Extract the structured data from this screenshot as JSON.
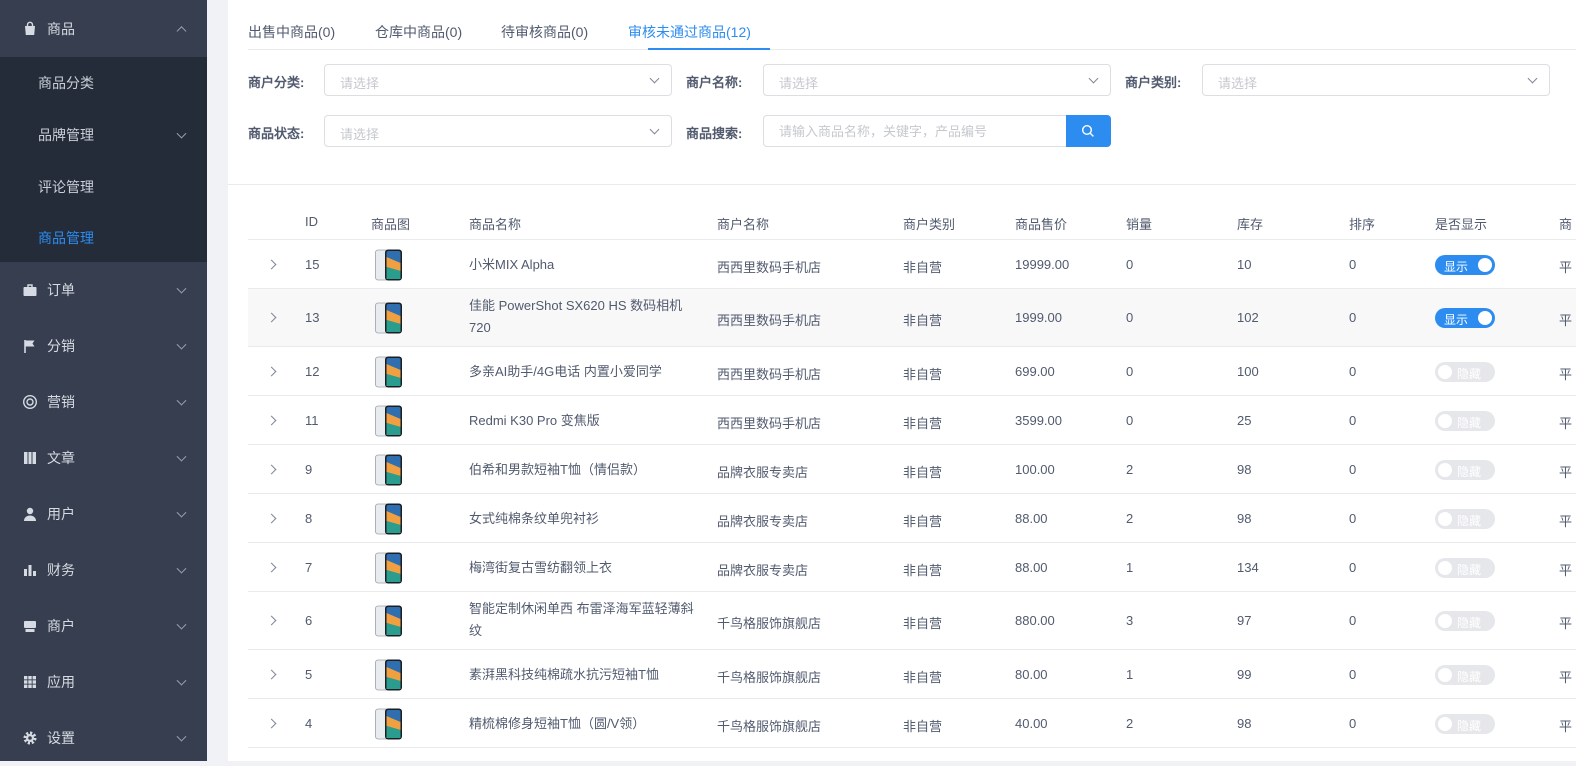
{
  "sidebar": {
    "menu": [
      {
        "label": "商品",
        "icon": "bag-icon"
      },
      {
        "label": "订单",
        "icon": "briefcase-icon"
      },
      {
        "label": "分销",
        "icon": "flag-icon"
      },
      {
        "label": "营销",
        "icon": "lifebuoy-icon"
      },
      {
        "label": "文章",
        "icon": "book-icon"
      },
      {
        "label": "用户",
        "icon": "user-icon"
      },
      {
        "label": "财务",
        "icon": "bar-chart-icon"
      },
      {
        "label": "商户",
        "icon": "store-icon"
      },
      {
        "label": "应用",
        "icon": "grid-icon"
      },
      {
        "label": "设置",
        "icon": "gear-icon"
      }
    ],
    "submenu": [
      {
        "label": "商品分类"
      },
      {
        "label": "品牌管理"
      },
      {
        "label": "评论管理"
      },
      {
        "label": "商品管理"
      }
    ]
  },
  "tabs": [
    {
      "label": "出售中商品(0)"
    },
    {
      "label": "仓库中商品(0)"
    },
    {
      "label": "待审核商品(0)"
    },
    {
      "label": "审核未通过商品(12)"
    }
  ],
  "filters": {
    "merchant_category": {
      "label": "商户分类:",
      "placeholder": "请选择"
    },
    "merchant_name": {
      "label": "商户名称:",
      "placeholder": "请选择"
    },
    "merchant_type": {
      "label": "商户类别:",
      "placeholder": "请选择"
    },
    "product_status": {
      "label": "商品状态:",
      "placeholder": "请选择"
    },
    "product_search": {
      "label": "商品搜索:",
      "placeholder": "请输入商品名称，关键字，产品编号"
    }
  },
  "table": {
    "headers": {
      "id": "ID",
      "image": "商品图",
      "name": "商品名称",
      "merchant": "商户名称",
      "merchant_type": "商户类别",
      "price": "商品售价",
      "sales": "销量",
      "stock": "库存",
      "sort": "排序",
      "show": "是否显示",
      "extra": "商"
    },
    "rows": [
      {
        "id": "15",
        "name": "小米MIX Alpha",
        "merchant": "西西里数码手机店",
        "type": "非自营",
        "price": "19999.00",
        "sales": "0",
        "stock": "10",
        "sort": "0",
        "show": "显示",
        "on": true,
        "extra": "平"
      },
      {
        "id": "13",
        "name": "佳能 PowerShot SX620 HS 数码相机 720",
        "merchant": "西西里数码手机店",
        "type": "非自营",
        "price": "1999.00",
        "sales": "0",
        "stock": "102",
        "sort": "0",
        "show": "显示",
        "on": true,
        "extra": "平"
      },
      {
        "id": "12",
        "name": "多亲AI助手/4G电话 内置小爱同学",
        "merchant": "西西里数码手机店",
        "type": "非自营",
        "price": "699.00",
        "sales": "0",
        "stock": "100",
        "sort": "0",
        "show": "隐藏",
        "on": false,
        "extra": "平"
      },
      {
        "id": "11",
        "name": "Redmi K30 Pro 变焦版",
        "merchant": "西西里数码手机店",
        "type": "非自营",
        "price": "3599.00",
        "sales": "0",
        "stock": "25",
        "sort": "0",
        "show": "隐藏",
        "on": false,
        "extra": "平"
      },
      {
        "id": "9",
        "name": "伯希和男款短袖T恤（情侣款）",
        "merchant": "品牌衣服专卖店",
        "type": "非自营",
        "price": "100.00",
        "sales": "2",
        "stock": "98",
        "sort": "0",
        "show": "隐藏",
        "on": false,
        "extra": "平"
      },
      {
        "id": "8",
        "name": "女式纯棉条纹单兜衬衫",
        "merchant": "品牌衣服专卖店",
        "type": "非自营",
        "price": "88.00",
        "sales": "2",
        "stock": "98",
        "sort": "0",
        "show": "隐藏",
        "on": false,
        "extra": "平"
      },
      {
        "id": "7",
        "name": "梅湾街复古雪纺翻领上衣",
        "merchant": "品牌衣服专卖店",
        "type": "非自营",
        "price": "88.00",
        "sales": "1",
        "stock": "134",
        "sort": "0",
        "show": "隐藏",
        "on": false,
        "extra": "平"
      },
      {
        "id": "6",
        "name": "智能定制休闲单西 布雷泽海军蓝轻薄斜纹",
        "merchant": "千鸟格服饰旗舰店",
        "type": "非自营",
        "price": "880.00",
        "sales": "3",
        "stock": "97",
        "sort": "0",
        "show": "隐藏",
        "on": false,
        "extra": "平"
      },
      {
        "id": "5",
        "name": "素湃黑科技纯棉疏水抗污短袖T恤",
        "merchant": "千鸟格服饰旗舰店",
        "type": "非自营",
        "price": "80.00",
        "sales": "1",
        "stock": "99",
        "sort": "0",
        "show": "隐藏",
        "on": false,
        "extra": "平"
      },
      {
        "id": "4",
        "name": "精梳棉修身短袖T恤（圆/V领）",
        "merchant": "千鸟格服饰旗舰店",
        "type": "非自营",
        "price": "40.00",
        "sales": "2",
        "stock": "98",
        "sort": "0",
        "show": "隐藏",
        "on": false,
        "extra": "平"
      }
    ]
  },
  "colors": {
    "sidebar_bg": "#363e4f",
    "submenu_bg": "#242c3a",
    "accent": "#2d8cf0"
  }
}
